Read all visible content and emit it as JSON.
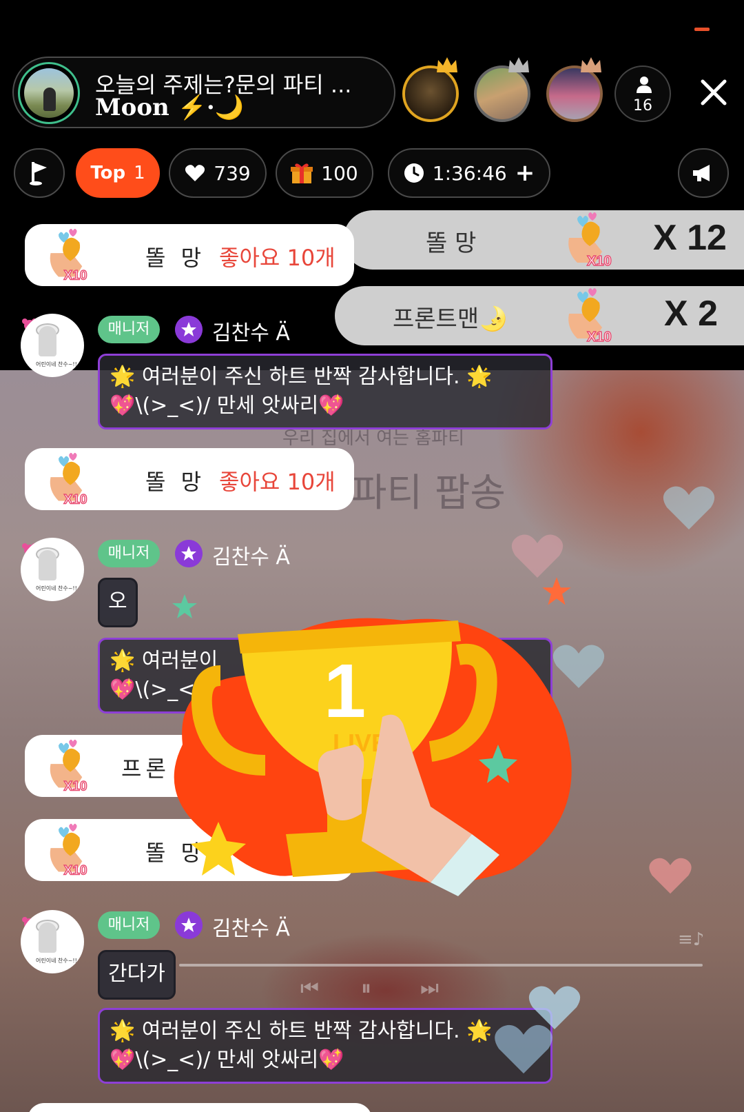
{
  "header": {
    "title": "오늘의 주제는?문의 파티 ...",
    "host_name": "Moon ⚡·🌙",
    "viewer_count": "16"
  },
  "stats": {
    "top_label": "Top",
    "top_rank": "1",
    "likes": "739",
    "gifts": "100",
    "timer": "1:36:46",
    "timer_plus": "+"
  },
  "combos": [
    {
      "name": "똘 망",
      "count": "X 12",
      "badge": "X10"
    },
    {
      "name": "프론트맨🌛",
      "count": "X 2",
      "badge": "X10"
    }
  ],
  "like_cards": [
    {
      "name": "똘 망",
      "text": "좋아요 10개",
      "badge": "X10"
    },
    {
      "name": "똘 망",
      "text": "좋아요 10개",
      "badge": "X10"
    },
    {
      "name": "프론",
      "text": "",
      "badge": "X10"
    },
    {
      "name": "똘 망",
      "text": "",
      "badge": "X10"
    }
  ],
  "chat": [
    {
      "role": "매니저",
      "user": "김찬수 Ä",
      "line1": "🌟 여러분이 주신 하트 반짝 감사합니다. 🌟",
      "line2": "💖\\(>_<)/ 만세 앗싸리💖"
    },
    {
      "role": "매니저",
      "user": "김찬수 Ä",
      "short": "오",
      "line1": "🌟 여러분이 ",
      "line2": "💖\\(>_<)/ "
    },
    {
      "role": "매니저",
      "user": "김찬수 Ä",
      "short": "간다가",
      "line1": "🌟 여러분이 주신 하트 반짝 감사합니다. 🌟",
      "line2": "💖\\(>_<)/ 만세 앗싸리💖"
    }
  ],
  "avatar_caption": "어린이네 찬수~!!",
  "background": {
    "watermark_small": "우리 집에서 여는 홈파티",
    "watermark_large": "파티 팝송"
  },
  "trophy": {
    "rank": "1",
    "label": "LIVE"
  },
  "colors": {
    "accent": "#ff4d1a",
    "manager_tag": "#5fc48a",
    "bubble_border": "#8e3fd6",
    "like_text": "#e8463a",
    "host_ring": "#3fbf8c"
  }
}
